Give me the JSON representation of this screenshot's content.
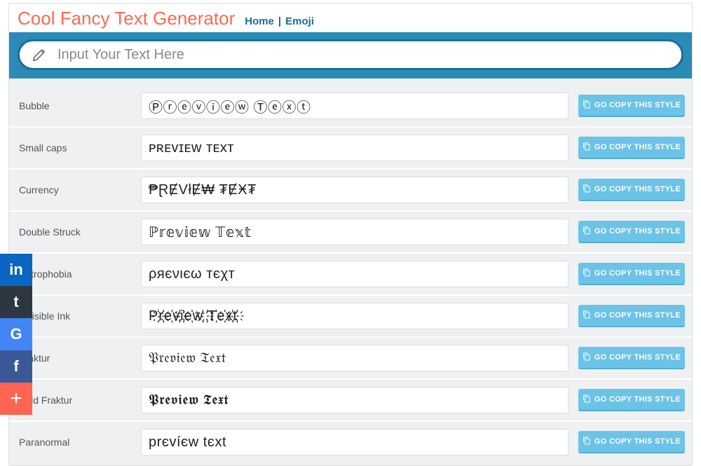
{
  "brand": "Cool Fancy Text Generator",
  "nav": {
    "home": "Home",
    "sep": "|",
    "emoji": "Emoji"
  },
  "input": {
    "placeholder": "Input Your Text Here",
    "value": ""
  },
  "copy_label": "GO COPY THIS STYLE",
  "styles": [
    {
      "name": "Bubble",
      "preview": "Ⓟⓡⓔⓥⓘⓔⓦ Ⓣⓔⓧⓣ"
    },
    {
      "name": "Small caps",
      "preview": "ᴘʀᴇᴠɪᴇᴡ ᴛᴇxᴛ"
    },
    {
      "name": "Currency",
      "preview": "₱ⱤɆVłɆ₩ ₮ɆӾ₮"
    },
    {
      "name": "Double Struck",
      "preview": "ℙ𝕣𝕖𝕧𝕚𝕖𝕨 𝕋𝕖𝕩𝕥"
    },
    {
      "name": "Antrophobia",
      "preview": "ρяєνιєω тєχт"
    },
    {
      "name": "Invisible Ink",
      "preview": "P҉r҉e҉v҉i҉e҉w҉ ҉T҉e҉x҉t҉"
    },
    {
      "name": "Fraktur",
      "preview": "𝔓𝔯𝔢𝔳𝔦𝔢𝔴 𝔗𝔢𝔵𝔱"
    },
    {
      "name": "Bold Fraktur",
      "preview": "𝕻𝖗𝖊𝖛𝖎𝖊𝖜 𝕿𝖊𝖝𝖙"
    },
    {
      "name": "Paranormal",
      "preview": "prєvíєw tєхt"
    }
  ],
  "social": {
    "linkedin": "in",
    "tumblr": "t",
    "google": "G",
    "facebook": "f",
    "more": "+"
  }
}
